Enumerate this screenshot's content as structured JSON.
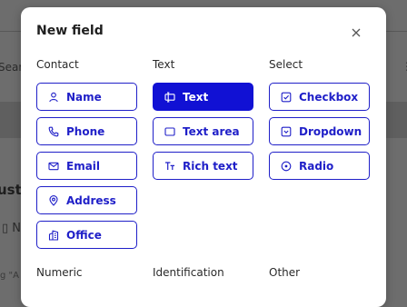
{
  "background": {
    "search_fragment": "Searc",
    "title_fragment": "ust d",
    "row_fragment": "N",
    "hint_fragment": "g \"A"
  },
  "modal": {
    "title": "New field",
    "close_icon": "close-icon",
    "columns": [
      {
        "heading": "Contact",
        "options": [
          {
            "label": "Name",
            "icon": "person-icon",
            "selected": false
          },
          {
            "label": "Phone",
            "icon": "phone-icon",
            "selected": false
          },
          {
            "label": "Email",
            "icon": "envelope-icon",
            "selected": false
          },
          {
            "label": "Address",
            "icon": "location-pin-icon",
            "selected": false
          },
          {
            "label": "Office",
            "icon": "building-icon",
            "selected": false
          }
        ]
      },
      {
        "heading": "Text",
        "options": [
          {
            "label": "Text",
            "icon": "text-cursor-icon",
            "selected": true
          },
          {
            "label": "Text area",
            "icon": "textarea-icon",
            "selected": false
          },
          {
            "label": "Rich text",
            "icon": "rich-text-icon",
            "selected": false
          }
        ]
      },
      {
        "heading": "Select",
        "options": [
          {
            "label": "Checkbox",
            "icon": "checkbox-icon",
            "selected": false
          },
          {
            "label": "Dropdown",
            "icon": "dropdown-icon",
            "selected": false
          },
          {
            "label": "Radio",
            "icon": "radio-icon",
            "selected": false
          }
        ]
      }
    ],
    "more_headings": [
      "Numeric",
      "Identification",
      "Other"
    ]
  },
  "colors": {
    "accent": "#1111d4",
    "accent_border": "#1f1fc8",
    "overlay": "#6d6d6d"
  }
}
